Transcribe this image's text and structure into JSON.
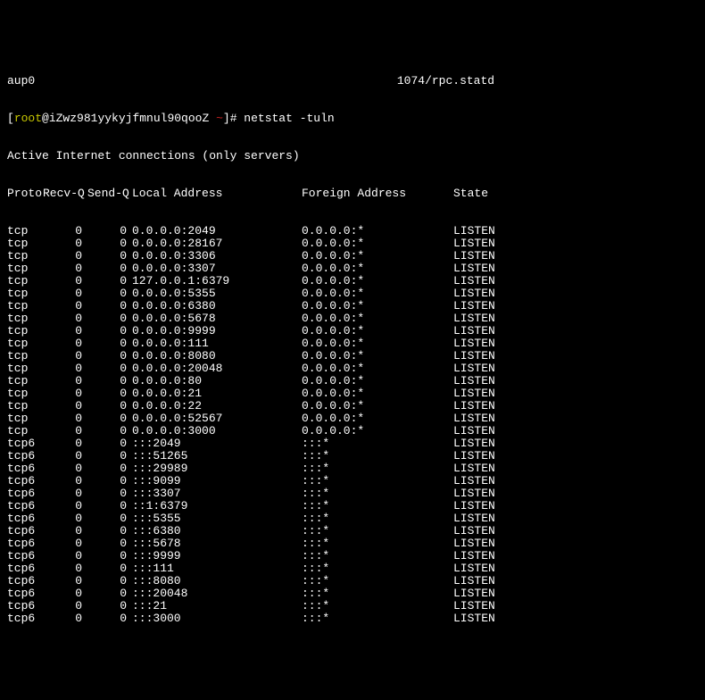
{
  "top_faint": "aup0                                                    1074/rpc.statd",
  "prompt": {
    "open": "[",
    "user": "root",
    "host": "@iZwz981yykyjfmnul90qooZ ",
    "tilde": "~",
    "close": "]# ",
    "command": "netstat -tuln"
  },
  "active_line": "Active Internet connections (only servers)",
  "headers": {
    "proto": "Proto",
    "recvq": "Recv-Q",
    "sendq": "Send-Q",
    "local": "Local Address",
    "foreign": "Foreign Address",
    "state": "State"
  },
  "rows": [
    {
      "proto": "tcp",
      "recvq": "0",
      "sendq": "0",
      "local": "0.0.0.0:2049",
      "foreign": "0.0.0.0:*",
      "state": "LISTEN"
    },
    {
      "proto": "tcp",
      "recvq": "0",
      "sendq": "0",
      "local": "0.0.0.0:28167",
      "foreign": "0.0.0.0:*",
      "state": "LISTEN"
    },
    {
      "proto": "tcp",
      "recvq": "0",
      "sendq": "0",
      "local": "0.0.0.0:3306",
      "foreign": "0.0.0.0:*",
      "state": "LISTEN"
    },
    {
      "proto": "tcp",
      "recvq": "0",
      "sendq": "0",
      "local": "0.0.0.0:3307",
      "foreign": "0.0.0.0:*",
      "state": "LISTEN"
    },
    {
      "proto": "tcp",
      "recvq": "0",
      "sendq": "0",
      "local": "127.0.0.1:6379",
      "foreign": "0.0.0.0:*",
      "state": "LISTEN"
    },
    {
      "proto": "tcp",
      "recvq": "0",
      "sendq": "0",
      "local": "0.0.0.0:5355",
      "foreign": "0.0.0.0:*",
      "state": "LISTEN"
    },
    {
      "proto": "tcp",
      "recvq": "0",
      "sendq": "0",
      "local": "0.0.0.0:6380",
      "foreign": "0.0.0.0:*",
      "state": "LISTEN"
    },
    {
      "proto": "tcp",
      "recvq": "0",
      "sendq": "0",
      "local": "0.0.0.0:5678",
      "foreign": "0.0.0.0:*",
      "state": "LISTEN"
    },
    {
      "proto": "tcp",
      "recvq": "0",
      "sendq": "0",
      "local": "0.0.0.0:9999",
      "foreign": "0.0.0.0:*",
      "state": "LISTEN"
    },
    {
      "proto": "tcp",
      "recvq": "0",
      "sendq": "0",
      "local": "0.0.0.0:111",
      "foreign": "0.0.0.0:*",
      "state": "LISTEN"
    },
    {
      "proto": "tcp",
      "recvq": "0",
      "sendq": "0",
      "local": "0.0.0.0:8080",
      "foreign": "0.0.0.0:*",
      "state": "LISTEN"
    },
    {
      "proto": "tcp",
      "recvq": "0",
      "sendq": "0",
      "local": "0.0.0.0:20048",
      "foreign": "0.0.0.0:*",
      "state": "LISTEN"
    },
    {
      "proto": "tcp",
      "recvq": "0",
      "sendq": "0",
      "local": "0.0.0.0:80",
      "foreign": "0.0.0.0:*",
      "state": "LISTEN"
    },
    {
      "proto": "tcp",
      "recvq": "0",
      "sendq": "0",
      "local": "0.0.0.0:21",
      "foreign": "0.0.0.0:*",
      "state": "LISTEN"
    },
    {
      "proto": "tcp",
      "recvq": "0",
      "sendq": "0",
      "local": "0.0.0.0:22",
      "foreign": "0.0.0.0:*",
      "state": "LISTEN"
    },
    {
      "proto": "tcp",
      "recvq": "0",
      "sendq": "0",
      "local": "0.0.0.0:52567",
      "foreign": "0.0.0.0:*",
      "state": "LISTEN"
    },
    {
      "proto": "tcp",
      "recvq": "0",
      "sendq": "0",
      "local": "0.0.0.0:3000",
      "foreign": "0.0.0.0:*",
      "state": "LISTEN"
    },
    {
      "proto": "tcp6",
      "recvq": "0",
      "sendq": "0",
      "local": ":::2049",
      "foreign": ":::*",
      "state": "LISTEN"
    },
    {
      "proto": "tcp6",
      "recvq": "0",
      "sendq": "0",
      "local": ":::51265",
      "foreign": ":::*",
      "state": "LISTEN"
    },
    {
      "proto": "tcp6",
      "recvq": "0",
      "sendq": "0",
      "local": ":::29989",
      "foreign": ":::*",
      "state": "LISTEN"
    },
    {
      "proto": "tcp6",
      "recvq": "0",
      "sendq": "0",
      "local": ":::9099",
      "foreign": ":::*",
      "state": "LISTEN"
    },
    {
      "proto": "tcp6",
      "recvq": "0",
      "sendq": "0",
      "local": ":::3307",
      "foreign": ":::*",
      "state": "LISTEN"
    },
    {
      "proto": "tcp6",
      "recvq": "0",
      "sendq": "0",
      "local": "::1:6379",
      "foreign": ":::*",
      "state": "LISTEN"
    },
    {
      "proto": "tcp6",
      "recvq": "0",
      "sendq": "0",
      "local": ":::5355",
      "foreign": ":::*",
      "state": "LISTEN"
    },
    {
      "proto": "tcp6",
      "recvq": "0",
      "sendq": "0",
      "local": ":::6380",
      "foreign": ":::*",
      "state": "LISTEN"
    },
    {
      "proto": "tcp6",
      "recvq": "0",
      "sendq": "0",
      "local": ":::5678",
      "foreign": ":::*",
      "state": "LISTEN"
    },
    {
      "proto": "tcp6",
      "recvq": "0",
      "sendq": "0",
      "local": ":::9999",
      "foreign": ":::*",
      "state": "LISTEN"
    },
    {
      "proto": "tcp6",
      "recvq": "0",
      "sendq": "0",
      "local": ":::111",
      "foreign": ":::*",
      "state": "LISTEN"
    },
    {
      "proto": "tcp6",
      "recvq": "0",
      "sendq": "0",
      "local": ":::8080",
      "foreign": ":::*",
      "state": "LISTEN"
    },
    {
      "proto": "tcp6",
      "recvq": "0",
      "sendq": "0",
      "local": ":::20048",
      "foreign": ":::*",
      "state": "LISTEN"
    },
    {
      "proto": "tcp6",
      "recvq": "0",
      "sendq": "0",
      "local": ":::21",
      "foreign": ":::*",
      "state": "LISTEN"
    },
    {
      "proto": "tcp6",
      "recvq": "0",
      "sendq": "0",
      "local": ":::3000",
      "foreign": ":::*",
      "state": "LISTEN"
    }
  ]
}
